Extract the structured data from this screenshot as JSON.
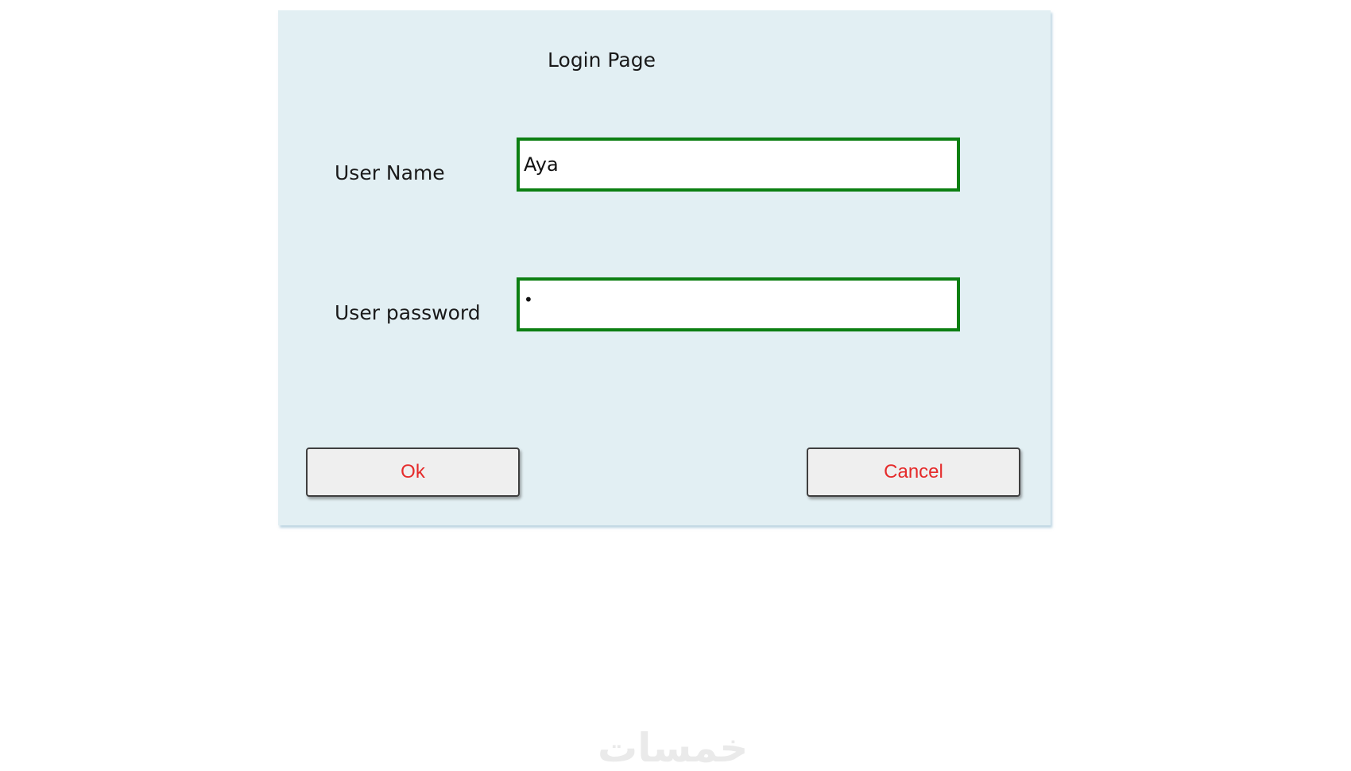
{
  "dialog": {
    "title": "Login Page",
    "background_color": "#e2eff3",
    "fields": {
      "username": {
        "label": "User Name",
        "value": "Aya"
      },
      "password": {
        "label": "User password",
        "value": "•"
      }
    },
    "field_border_color": "#0c7f12",
    "buttons": {
      "ok_label": "Ok",
      "cancel_label": "Cancel",
      "label_color": "#e52b2b"
    }
  },
  "watermark": {
    "text": "خمسات"
  }
}
